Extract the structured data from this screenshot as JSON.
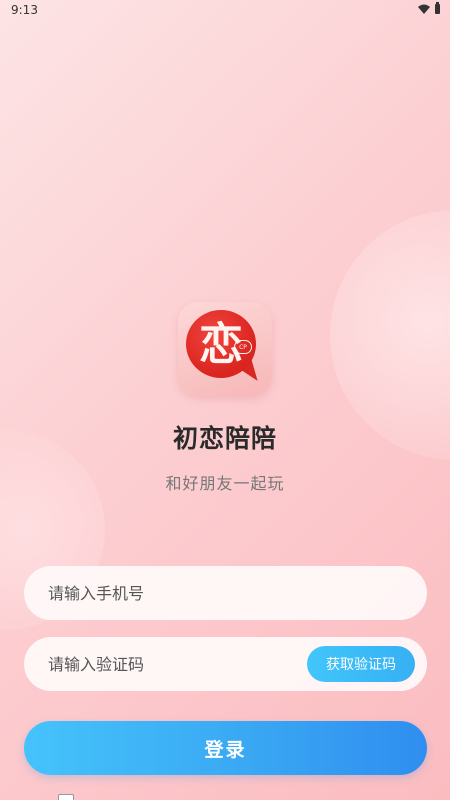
{
  "status_bar": {
    "time": "9:13",
    "icons": [
      "wifi-icon",
      "battery-icon"
    ]
  },
  "app": {
    "logo_char": "恋",
    "logo_badge": "CP",
    "name": "初恋陪陪",
    "slogan": "和好朋友一起玩"
  },
  "form": {
    "phone_placeholder": "请输入手机号",
    "code_placeholder": "请输入验证码",
    "get_code_label": "获取验证码",
    "login_label": "登录"
  },
  "colors": {
    "accent_blue": "#3aa8f3",
    "logo_red": "#d9241f",
    "background_pink": "#fccfd2"
  }
}
